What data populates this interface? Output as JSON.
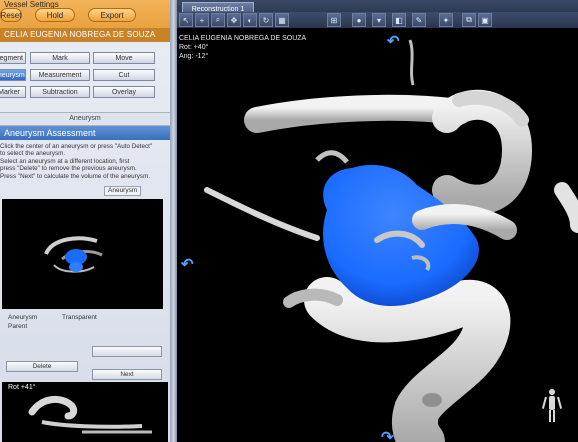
{
  "left_panel": {
    "app_subtitle": "Vessel Settings",
    "header_buttons": [
      "Reset",
      "Hold",
      "Export"
    ],
    "patient_name": "CELIA EUGENIA NOBREGA DE SOUZA",
    "grid_buttons": [
      [
        "Segment",
        "Mark",
        "Move"
      ],
      [
        "Aneurysm",
        "Measurement",
        "Cut"
      ],
      [
        "Marker",
        "Subtraction",
        "Overlay"
      ]
    ],
    "active_button": "Aneurysm",
    "section_label": "Aneurysm",
    "tool_title": "Aneurysm Assessment",
    "instructions": [
      "Click the center of an aneurysm or press \"Auto Detect\"",
      "to select the aneurysm.",
      "Select an aneurysm at a different location, first",
      "press \"Delete\" to remove the previous aneurysm.",
      "Press \"Next\" to calculate the volume of the aneurysm."
    ],
    "tabs": [
      "Aneurysm"
    ],
    "legend": [
      "Aneurysm",
      "Transparent",
      "Parent"
    ],
    "panel_buttons": [
      "Delete",
      "Next"
    ],
    "bottom_rotation": "Rot  +41°"
  },
  "main": {
    "tab_title": "Reconstruction 1",
    "patient_name": "CELIA EUGENIA NOBREGA DE SOUZA",
    "rotation": "Rot:  +40°",
    "angle": "Ang:  -12°",
    "toolbar_icons": [
      "arrow-icon",
      "crosshair-icon",
      "zoom-icon",
      "pan-icon",
      "window-icon",
      "rotate-icon",
      "layout-icon",
      "measure-icon",
      "sphere-icon",
      "lut-icon",
      "filter-icon",
      "marker-icon",
      "light-icon",
      "snapshot-icon",
      "grid-icon"
    ]
  },
  "colors": {
    "aneurysm_blue": "#1a6bff",
    "vessel_gray": "#cfcfcf",
    "panel_orange": "#e49a35"
  }
}
